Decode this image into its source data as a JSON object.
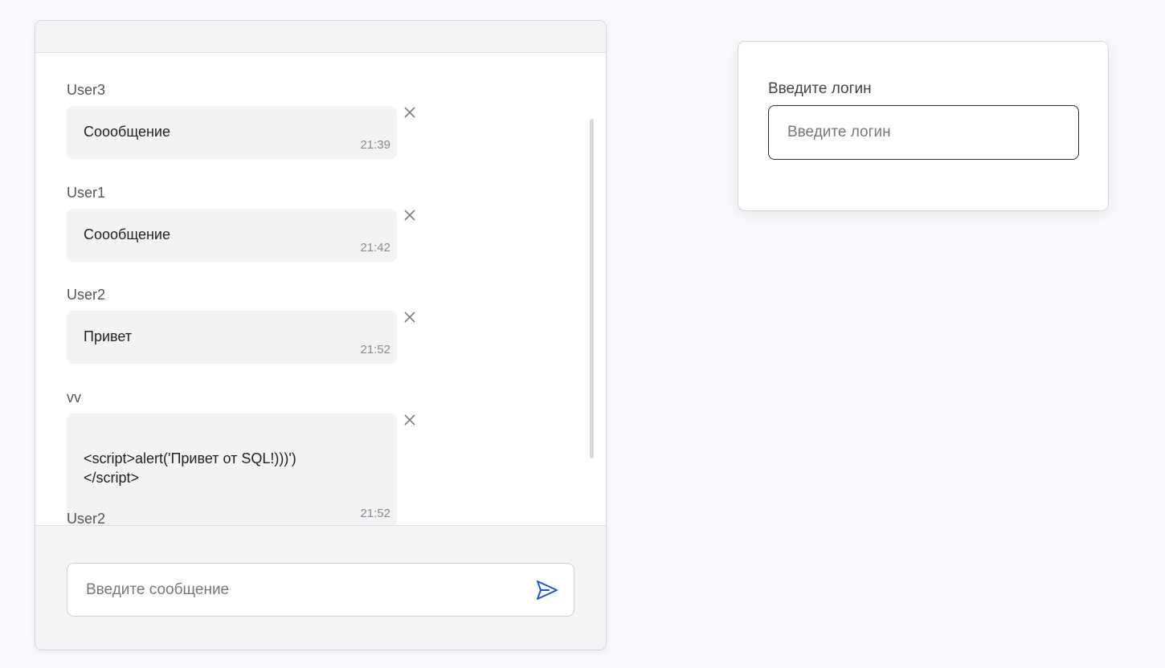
{
  "chat": {
    "messages": [
      {
        "author": "User3",
        "text": "Сooобщение",
        "time": "21:39"
      },
      {
        "author": "User1",
        "text": "Сooобщение",
        "time": "21:42"
      },
      {
        "author": "User2",
        "text": "Привет",
        "time": "21:52"
      },
      {
        "author": "vv",
        "text": "<script>alert('Привет от SQL!)))')\n</script>",
        "time": "21:52"
      },
      {
        "author": "User2"
      }
    ],
    "input": {
      "placeholder": "Введите сообщение",
      "value": ""
    }
  },
  "login": {
    "label": "Введите логин",
    "placeholder": "Введите логин",
    "value": ""
  },
  "colors": {
    "accent": "#1a56db",
    "bubble_bg": "#f3f3f5",
    "page_bg": "#f8f9fc"
  },
  "icons": {
    "delete": "close-icon",
    "send": "send-icon"
  }
}
